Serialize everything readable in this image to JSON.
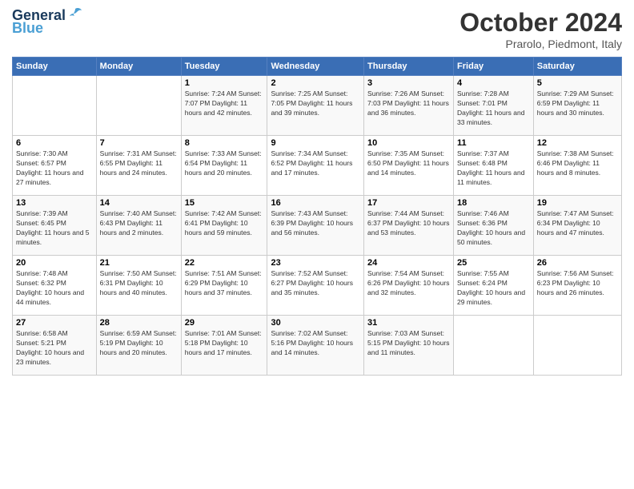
{
  "logo": {
    "line1": "General",
    "line2": "Blue"
  },
  "title": "October 2024",
  "subtitle": "Prarolo, Piedmont, Italy",
  "days_of_week": [
    "Sunday",
    "Monday",
    "Tuesday",
    "Wednesday",
    "Thursday",
    "Friday",
    "Saturday"
  ],
  "weeks": [
    [
      {
        "day": "",
        "info": ""
      },
      {
        "day": "",
        "info": ""
      },
      {
        "day": "1",
        "info": "Sunrise: 7:24 AM\nSunset: 7:07 PM\nDaylight: 11 hours and 42 minutes."
      },
      {
        "day": "2",
        "info": "Sunrise: 7:25 AM\nSunset: 7:05 PM\nDaylight: 11 hours and 39 minutes."
      },
      {
        "day": "3",
        "info": "Sunrise: 7:26 AM\nSunset: 7:03 PM\nDaylight: 11 hours and 36 minutes."
      },
      {
        "day": "4",
        "info": "Sunrise: 7:28 AM\nSunset: 7:01 PM\nDaylight: 11 hours and 33 minutes."
      },
      {
        "day": "5",
        "info": "Sunrise: 7:29 AM\nSunset: 6:59 PM\nDaylight: 11 hours and 30 minutes."
      }
    ],
    [
      {
        "day": "6",
        "info": "Sunrise: 7:30 AM\nSunset: 6:57 PM\nDaylight: 11 hours and 27 minutes."
      },
      {
        "day": "7",
        "info": "Sunrise: 7:31 AM\nSunset: 6:55 PM\nDaylight: 11 hours and 24 minutes."
      },
      {
        "day": "8",
        "info": "Sunrise: 7:33 AM\nSunset: 6:54 PM\nDaylight: 11 hours and 20 minutes."
      },
      {
        "day": "9",
        "info": "Sunrise: 7:34 AM\nSunset: 6:52 PM\nDaylight: 11 hours and 17 minutes."
      },
      {
        "day": "10",
        "info": "Sunrise: 7:35 AM\nSunset: 6:50 PM\nDaylight: 11 hours and 14 minutes."
      },
      {
        "day": "11",
        "info": "Sunrise: 7:37 AM\nSunset: 6:48 PM\nDaylight: 11 hours and 11 minutes."
      },
      {
        "day": "12",
        "info": "Sunrise: 7:38 AM\nSunset: 6:46 PM\nDaylight: 11 hours and 8 minutes."
      }
    ],
    [
      {
        "day": "13",
        "info": "Sunrise: 7:39 AM\nSunset: 6:45 PM\nDaylight: 11 hours and 5 minutes."
      },
      {
        "day": "14",
        "info": "Sunrise: 7:40 AM\nSunset: 6:43 PM\nDaylight: 11 hours and 2 minutes."
      },
      {
        "day": "15",
        "info": "Sunrise: 7:42 AM\nSunset: 6:41 PM\nDaylight: 10 hours and 59 minutes."
      },
      {
        "day": "16",
        "info": "Sunrise: 7:43 AM\nSunset: 6:39 PM\nDaylight: 10 hours and 56 minutes."
      },
      {
        "day": "17",
        "info": "Sunrise: 7:44 AM\nSunset: 6:37 PM\nDaylight: 10 hours and 53 minutes."
      },
      {
        "day": "18",
        "info": "Sunrise: 7:46 AM\nSunset: 6:36 PM\nDaylight: 10 hours and 50 minutes."
      },
      {
        "day": "19",
        "info": "Sunrise: 7:47 AM\nSunset: 6:34 PM\nDaylight: 10 hours and 47 minutes."
      }
    ],
    [
      {
        "day": "20",
        "info": "Sunrise: 7:48 AM\nSunset: 6:32 PM\nDaylight: 10 hours and 44 minutes."
      },
      {
        "day": "21",
        "info": "Sunrise: 7:50 AM\nSunset: 6:31 PM\nDaylight: 10 hours and 40 minutes."
      },
      {
        "day": "22",
        "info": "Sunrise: 7:51 AM\nSunset: 6:29 PM\nDaylight: 10 hours and 37 minutes."
      },
      {
        "day": "23",
        "info": "Sunrise: 7:52 AM\nSunset: 6:27 PM\nDaylight: 10 hours and 35 minutes."
      },
      {
        "day": "24",
        "info": "Sunrise: 7:54 AM\nSunset: 6:26 PM\nDaylight: 10 hours and 32 minutes."
      },
      {
        "day": "25",
        "info": "Sunrise: 7:55 AM\nSunset: 6:24 PM\nDaylight: 10 hours and 29 minutes."
      },
      {
        "day": "26",
        "info": "Sunrise: 7:56 AM\nSunset: 6:23 PM\nDaylight: 10 hours and 26 minutes."
      }
    ],
    [
      {
        "day": "27",
        "info": "Sunrise: 6:58 AM\nSunset: 5:21 PM\nDaylight: 10 hours and 23 minutes."
      },
      {
        "day": "28",
        "info": "Sunrise: 6:59 AM\nSunset: 5:19 PM\nDaylight: 10 hours and 20 minutes."
      },
      {
        "day": "29",
        "info": "Sunrise: 7:01 AM\nSunset: 5:18 PM\nDaylight: 10 hours and 17 minutes."
      },
      {
        "day": "30",
        "info": "Sunrise: 7:02 AM\nSunset: 5:16 PM\nDaylight: 10 hours and 14 minutes."
      },
      {
        "day": "31",
        "info": "Sunrise: 7:03 AM\nSunset: 5:15 PM\nDaylight: 10 hours and 11 minutes."
      },
      {
        "day": "",
        "info": ""
      },
      {
        "day": "",
        "info": ""
      }
    ]
  ]
}
